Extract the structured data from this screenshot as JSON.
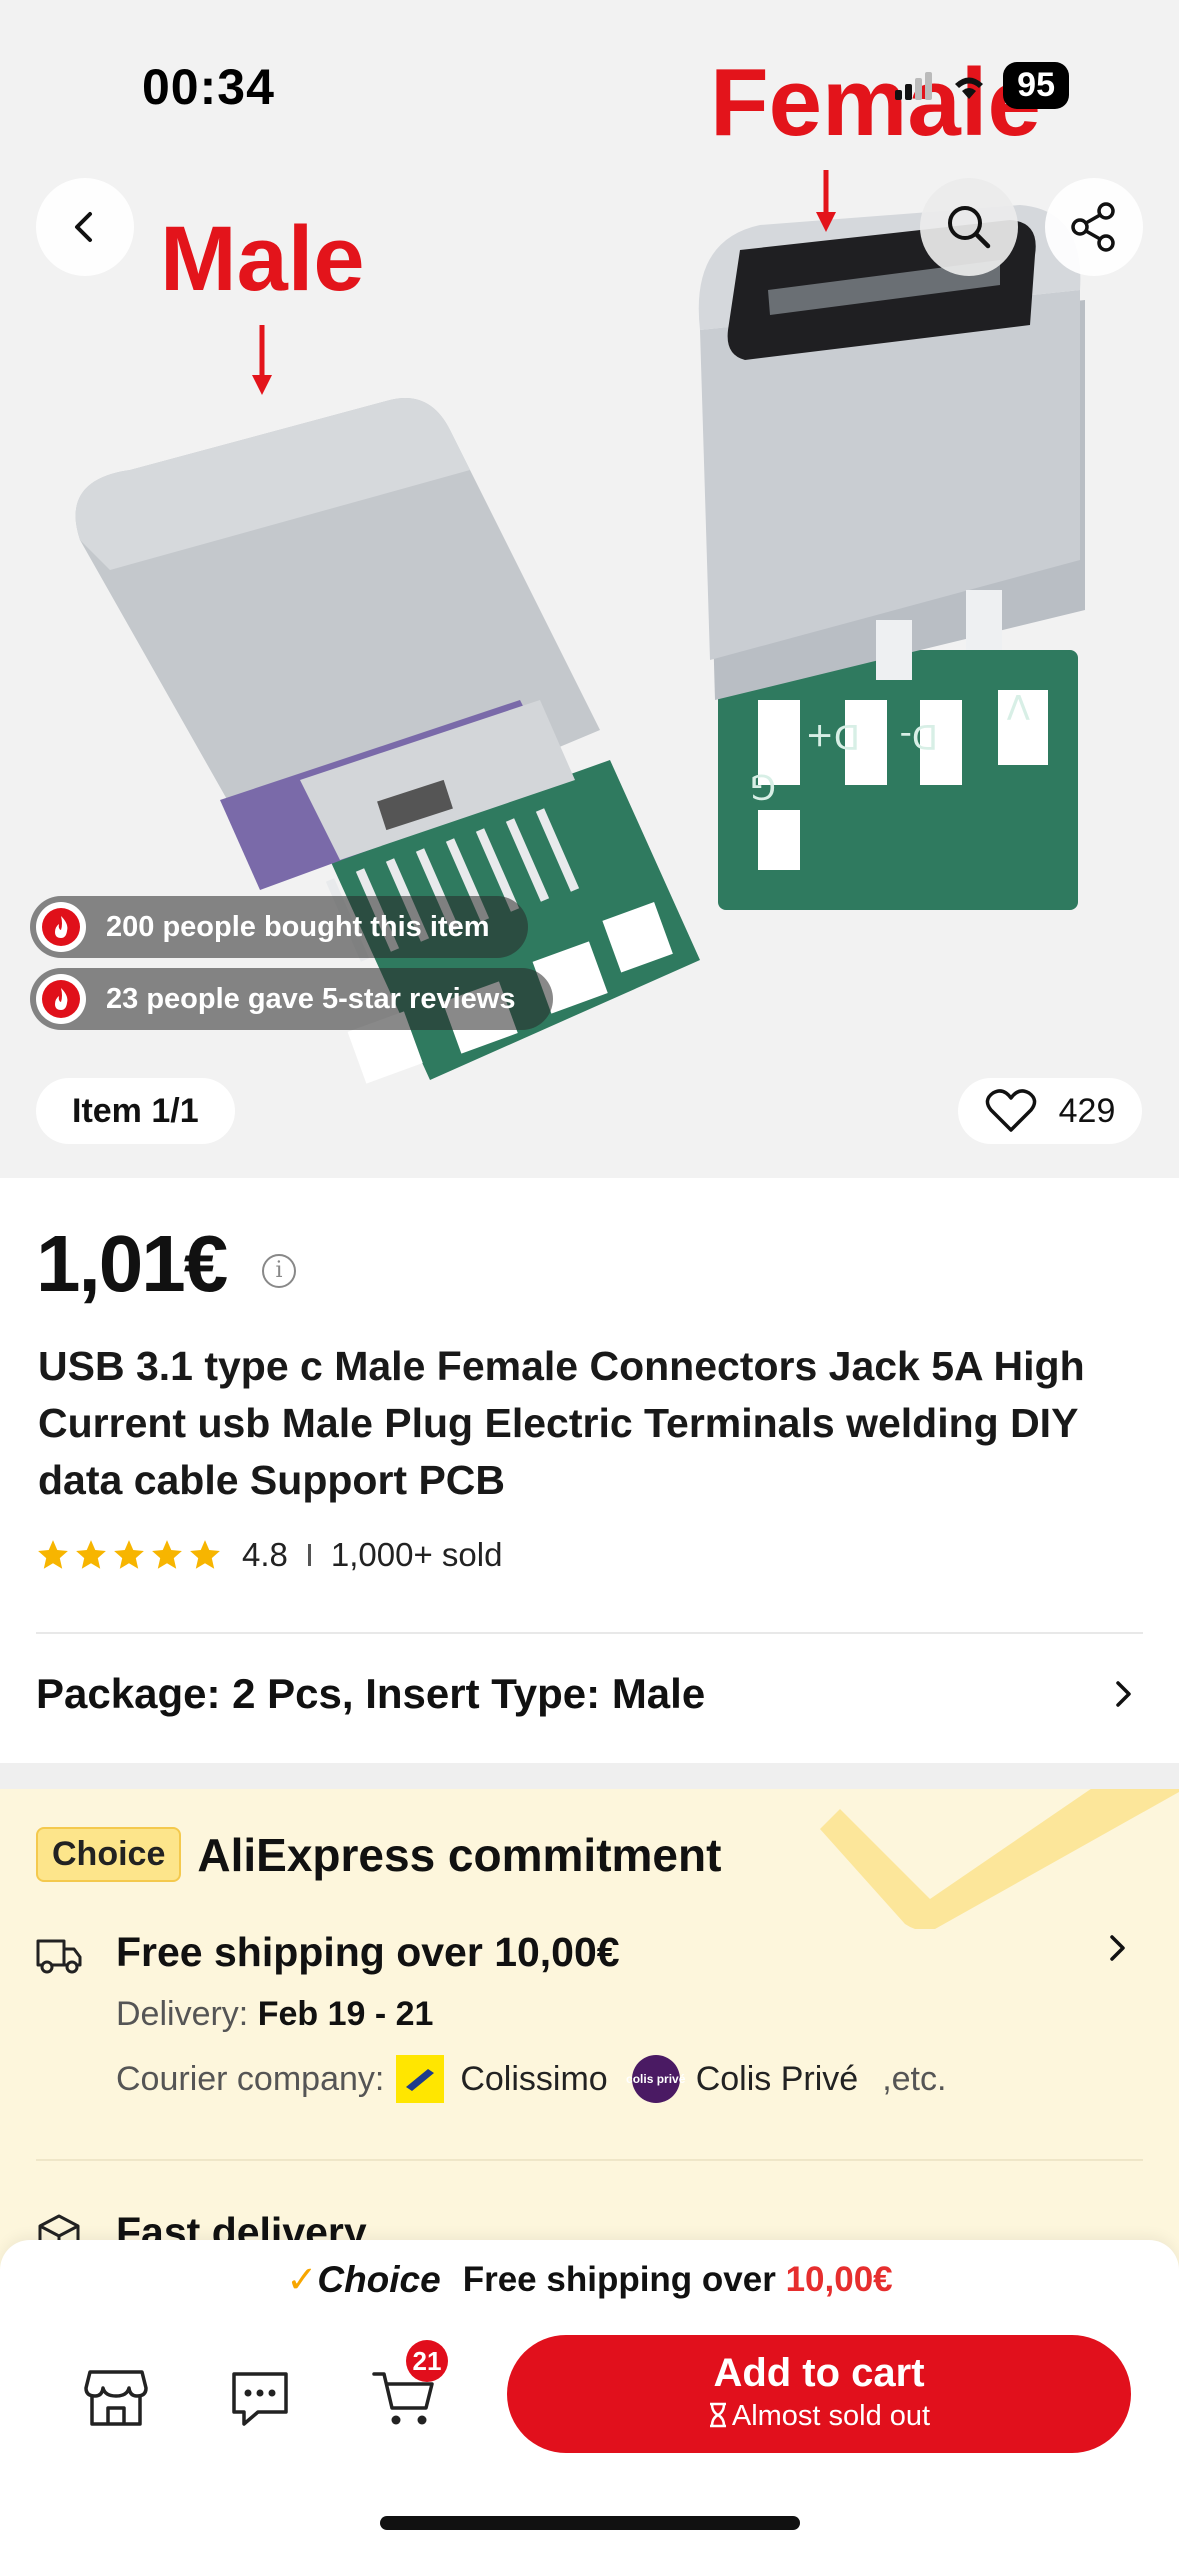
{
  "status_bar": {
    "time": "00:34",
    "battery": "95"
  },
  "hero": {
    "label_male": "Male",
    "label_female": "Female",
    "badges": [
      "200 people bought this item",
      "23 people gave 5-star reviews"
    ],
    "item_counter": "Item 1/1",
    "likes": "429",
    "pcb_pin_labels": [
      "G",
      "D+",
      "D-",
      "V"
    ]
  },
  "icons": {
    "back": "chevron-left-icon",
    "search": "search-icon",
    "share": "share-icon",
    "fire": "fire-icon",
    "heart": "heart-icon",
    "info": "info-icon",
    "star": "star-icon",
    "chevron": "chevron-right-icon",
    "truck": "truck-icon",
    "box": "box-icon",
    "store": "store-icon",
    "chat": "chat-icon",
    "cart": "cart-icon",
    "hourglass": "hourglass-icon"
  },
  "product": {
    "price": "1,01€",
    "title": "USB 3.1 type c Male Female Connectors Jack 5A High Current usb Male Plug Electric Terminals welding DIY data cable Support PCB",
    "rating": "4.8",
    "sold": "1,000+ sold",
    "stars": 5,
    "variant": "Package: 2 Pcs, Insert Type: Male"
  },
  "commitment": {
    "badge": "Choice",
    "title": "AliExpress commitment",
    "shipping_title": "Free shipping over 10,00€",
    "delivery_label": "Delivery:",
    "delivery_dates": "Feb 19 - 21",
    "courier_label": "Courier company:",
    "couriers": [
      "Colissimo",
      "Colis Privé"
    ],
    "courier_etc": ",etc.",
    "colisprive_logo_text": "colis privé",
    "fast_delivery": "Fast delivery"
  },
  "bottom_bar": {
    "promo_choice": "Choice",
    "promo_text": "Free shipping over",
    "promo_amount": "10,00€",
    "cart_count": "21",
    "add_to_cart": "Add to cart",
    "stock_note": "Almost sold out"
  },
  "colors": {
    "accent_red": "#e1101c",
    "price_red": "#e62e2e",
    "star_yellow": "#f7b500",
    "choice_yellow": "#fde58b",
    "commit_bg": "#fdf6dc"
  }
}
